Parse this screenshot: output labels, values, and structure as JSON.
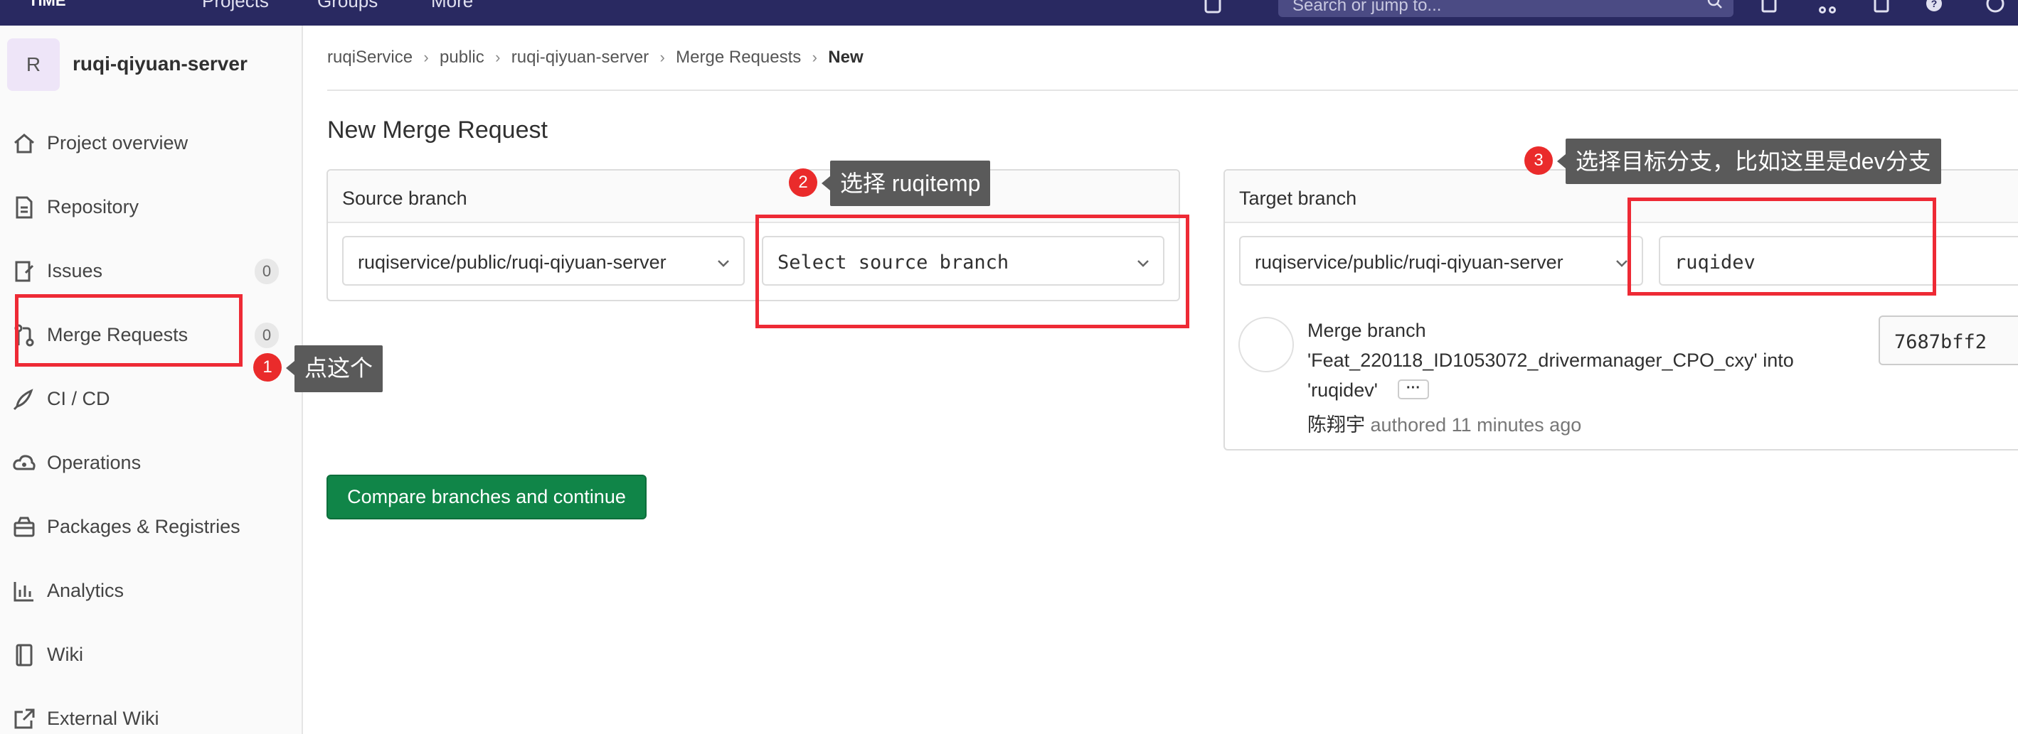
{
  "topbar": {
    "logo": "TIME",
    "nav_links": [
      "Projects",
      "Groups",
      "More"
    ],
    "search_placeholder": "Search or jump to..."
  },
  "sidebar": {
    "avatar_letter": "R",
    "project_name": "ruqi-qiyuan-server",
    "items": [
      {
        "label": "Project overview",
        "icon": "home-icon"
      },
      {
        "label": "Repository",
        "icon": "document-icon"
      },
      {
        "label": "Issues",
        "icon": "issues-icon",
        "badge": "0"
      },
      {
        "label": "Merge Requests",
        "icon": "merge-request-icon",
        "badge": "0"
      },
      {
        "label": "CI / CD",
        "icon": "rocket-icon"
      },
      {
        "label": "Operations",
        "icon": "cloud-gear-icon"
      },
      {
        "label": "Packages & Registries",
        "icon": "package-icon"
      },
      {
        "label": "Analytics",
        "icon": "chart-icon"
      },
      {
        "label": "Wiki",
        "icon": "book-icon"
      },
      {
        "label": "External Wiki",
        "icon": "external-link-icon"
      }
    ]
  },
  "breadcrumb": [
    "ruqiService",
    "public",
    "ruqi-qiyuan-server",
    "Merge Requests",
    "New"
  ],
  "page_title": "New Merge Request",
  "source": {
    "title": "Source branch",
    "project": "ruqiservice/public/ruqi-qiyuan-server",
    "branch_placeholder": "Select source branch"
  },
  "target": {
    "title": "Target branch",
    "project": "ruqiservice/public/ruqi-qiyuan-server",
    "branch": "ruqidev"
  },
  "commit": {
    "title_line1": "Merge branch",
    "title_line2": "'Feat_220118_ID1053072_drivermanager_CPO_cxy' into",
    "title_line3": "'ruqidev'",
    "ellipsis": "···",
    "author": "陈翔宇",
    "authored_text": "authored 11 minutes ago",
    "sha": "7687bff2"
  },
  "compare_button": "Compare branches and continue",
  "annotations": [
    {
      "number": "1",
      "text": "点这个"
    },
    {
      "number": "2",
      "text": "选择 ruqitemp"
    },
    {
      "number": "3",
      "text": "选择目标分支，比如这里是dev分支"
    }
  ],
  "colors": {
    "navbar": "#292961",
    "primary_button": "#108548",
    "annotation_red": "#ee2a35",
    "tooltip_bg": "#5a5a5a"
  }
}
